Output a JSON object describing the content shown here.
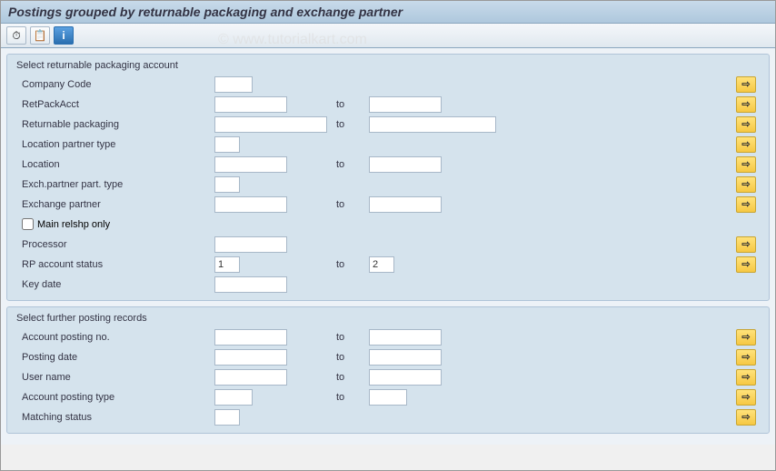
{
  "title": "Postings grouped by returnable packaging and exchange partner",
  "watermark": "© www.tutorialkart.com",
  "toolbar": {
    "execute_icon": "⏱",
    "variant_icon": "📋",
    "info_icon": "ℹ"
  },
  "arrow": "⇨",
  "to": "to",
  "section1": {
    "title": "Select returnable packaging account",
    "company_code": "Company Code",
    "retpackacct": "RetPackAcct",
    "returnable_packaging": "Returnable packaging",
    "location_partner_type": "Location partner type",
    "location": "Location",
    "exch_partner_part_type": "Exch.partner part. type",
    "exchange_partner": "Exchange partner",
    "main_relshp_only": "Main relshp only",
    "processor": "Processor",
    "rp_account_status": "RP account status",
    "rp_from": "1",
    "rp_to": "2",
    "key_date": "Key date"
  },
  "section2": {
    "title": "Select further posting records",
    "account_posting_no": "Account posting no.",
    "posting_date": "Posting date",
    "user_name": "User name",
    "account_posting_type": "Account posting type",
    "matching_status": "Matching status"
  }
}
